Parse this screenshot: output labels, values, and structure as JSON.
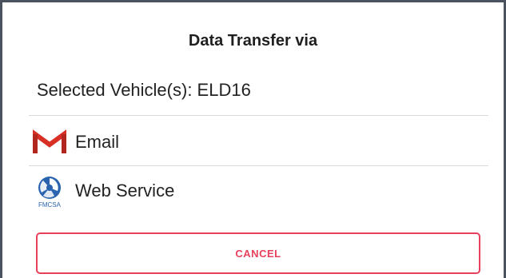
{
  "dialog": {
    "title": "Data Transfer via",
    "selected_vehicles": "Selected Vehicle(s): ELD16"
  },
  "options": [
    {
      "label": "Email",
      "icon": "gmail-icon"
    },
    {
      "label": "Web Service",
      "icon": "fmcsa-icon",
      "icon_text": "FMCSA"
    }
  ],
  "cancel_label": "CANCEL",
  "colors": {
    "accent": "#e8405c",
    "gmail_red": "#d93025",
    "fmcsa_blue": "#2a64ae",
    "divider": "#d9d9d9",
    "frame": "#4a525d"
  }
}
